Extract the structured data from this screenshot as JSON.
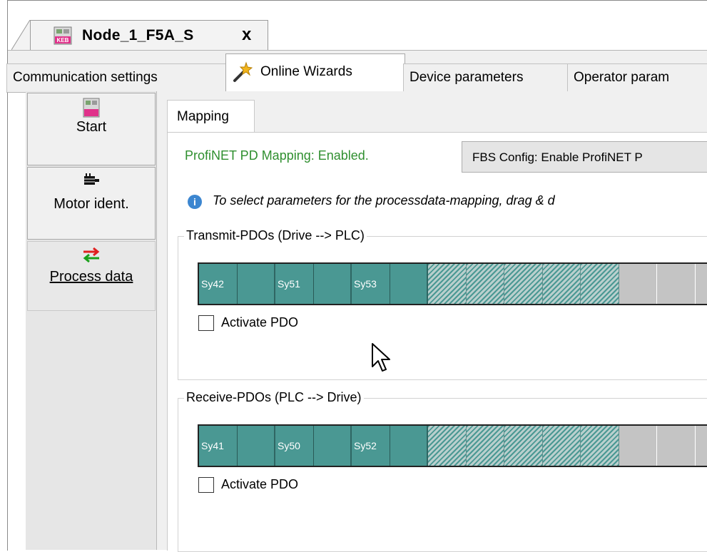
{
  "document_tab": {
    "title": "Node_1_F5A_S",
    "close_label": "x",
    "logo_text": "KEB"
  },
  "tabs": [
    {
      "label": "Communication settings"
    },
    {
      "label": "Online Wizards"
    },
    {
      "label": "Device parameters"
    },
    {
      "label": "Operator param"
    }
  ],
  "sidebar": {
    "items": [
      {
        "label": "Start",
        "icon": "keb-device-icon"
      },
      {
        "label": "Motor ident.",
        "icon": "motor-icon"
      },
      {
        "label": "Process data",
        "icon": "swap-arrows-icon"
      }
    ]
  },
  "mapping": {
    "tab_label": "Mapping",
    "status_text": "ProfiNET PD Mapping: Enabled.",
    "fbs_button_label": "FBS Config: Enable ProfiNET P",
    "info_text": "To select parameters for the processdata-mapping, drag & d"
  },
  "transmit": {
    "legend": "Transmit-PDOs  (Drive --> PLC)",
    "cells": [
      "Sy42",
      "Sy51",
      "Sy53"
    ],
    "activate_label": "Activate PDO"
  },
  "receive": {
    "legend": "Receive-PDOs  (PLC --> Drive)",
    "cells": [
      "Sy41",
      "Sy50",
      "Sy52"
    ],
    "activate_label": "Activate PDO"
  },
  "colors": {
    "pdo_filled": "#4a9893",
    "status_green": "#2f8f2f",
    "empty": "#c4c4c4"
  }
}
